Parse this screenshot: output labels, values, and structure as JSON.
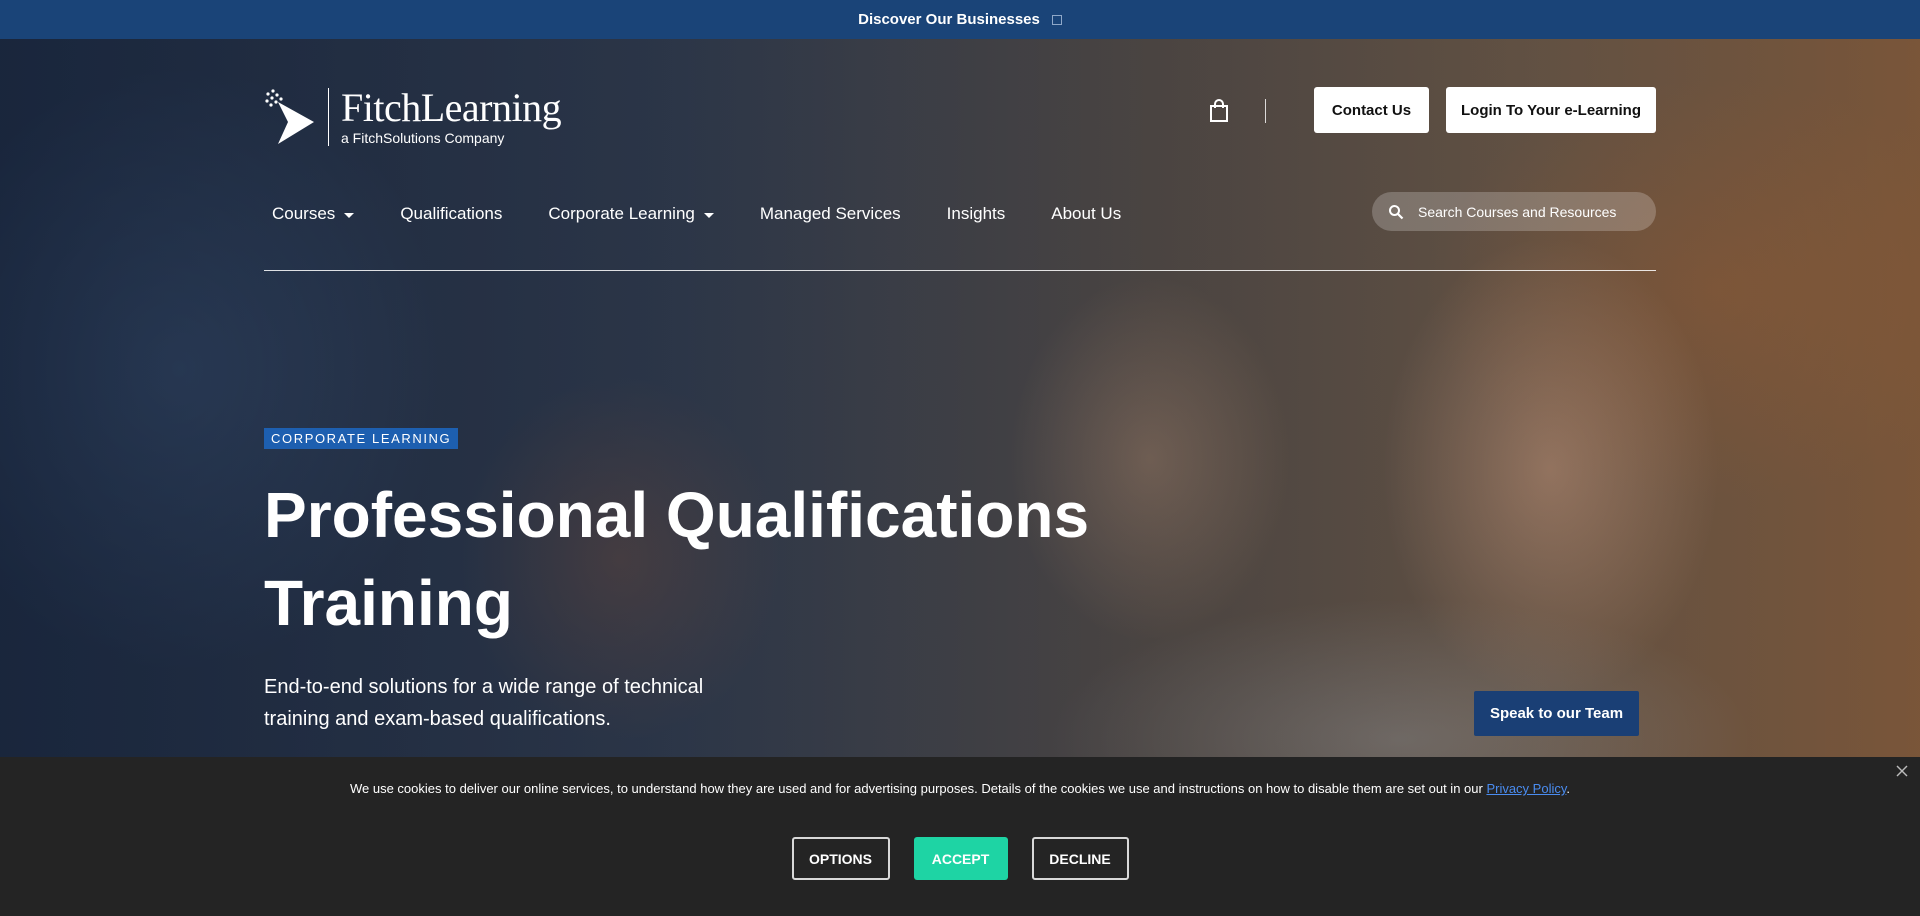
{
  "topbar": {
    "label": "Discover Our Businesses"
  },
  "logo": {
    "name": "FitchLearning",
    "tagline": "a FitchSolutions Company"
  },
  "header": {
    "contact_label": "Contact Us",
    "login_label": "Login To Your e-Learning"
  },
  "nav": {
    "items": [
      {
        "label": "Courses",
        "dropdown": true
      },
      {
        "label": "Qualifications",
        "dropdown": false
      },
      {
        "label": "Corporate Learning",
        "dropdown": true
      },
      {
        "label": "Managed Services",
        "dropdown": false
      },
      {
        "label": "Insights",
        "dropdown": false
      },
      {
        "label": "About Us",
        "dropdown": false
      }
    ],
    "search_placeholder": "Search Courses and Resources"
  },
  "hero": {
    "badge": "CORPORATE LEARNING",
    "title_line1": "Professional Qualifications",
    "title_line2": "Training",
    "subtitle_line1": "End-to-end solutions for a wide range of technical",
    "subtitle_line2": "training and exam-based qualifications.",
    "cta_label": "Speak to our Team"
  },
  "cookie": {
    "text": "We use cookies to deliver our online services, to understand how they are used and for advertising purposes. Details of the cookies we use and instructions on how to disable them are set out in our ",
    "link_label": "Privacy Policy",
    "text_end": ".",
    "options_label": "OPTIONS",
    "accept_label": "ACCEPT",
    "decline_label": "DECLINE"
  },
  "colors": {
    "topbar": "#1a4478",
    "badge": "#1d5fb0",
    "cta": "#1a3f75",
    "accept": "#1ed4a4",
    "cookie_bg": "#242424",
    "link": "#4a8cf0"
  },
  "icons": [
    "external-box-icon",
    "logo-arrow-icon",
    "shopping-bag-icon",
    "caret-down-icon",
    "search-icon",
    "close-icon"
  ]
}
